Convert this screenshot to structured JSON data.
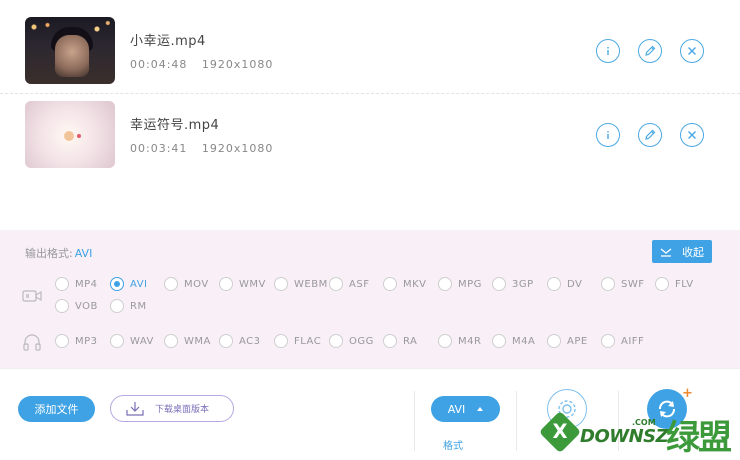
{
  "files": [
    {
      "name": "小幸运.mp4",
      "duration": "00:04:48",
      "resolution": "1920x1080"
    },
    {
      "name": "幸运符号.mp4",
      "duration": "00:03:41",
      "resolution": "1920x1080"
    }
  ],
  "output": {
    "label": "输出格式:",
    "value": "AVI",
    "collapse_label": "收起"
  },
  "video_formats": [
    "MP4",
    "AVI",
    "MOV",
    "WMV",
    "WEBM",
    "ASF",
    "MKV",
    "MPG",
    "3GP",
    "DV",
    "SWF",
    "FLV",
    "VOB",
    "RM"
  ],
  "audio_formats": [
    "MP3",
    "WAV",
    "WMA",
    "AC3",
    "FLAC",
    "OGG",
    "RA",
    "M4R",
    "M4A",
    "APE",
    "AIFF"
  ],
  "selected_format": "AVI",
  "bottom": {
    "add_file": "添加文件",
    "download_desktop": "下载桌面版本",
    "format_button": "AVI",
    "format_label": "格式"
  },
  "watermark": {
    "x": "X",
    "brand": "DOWNSZ",
    "com": ".COM",
    "cn": "绿盟"
  },
  "colors": {
    "accent": "#3ea2e4",
    "panel_bg": "#f8eff7",
    "watermark_green": "#3c9a3a"
  }
}
